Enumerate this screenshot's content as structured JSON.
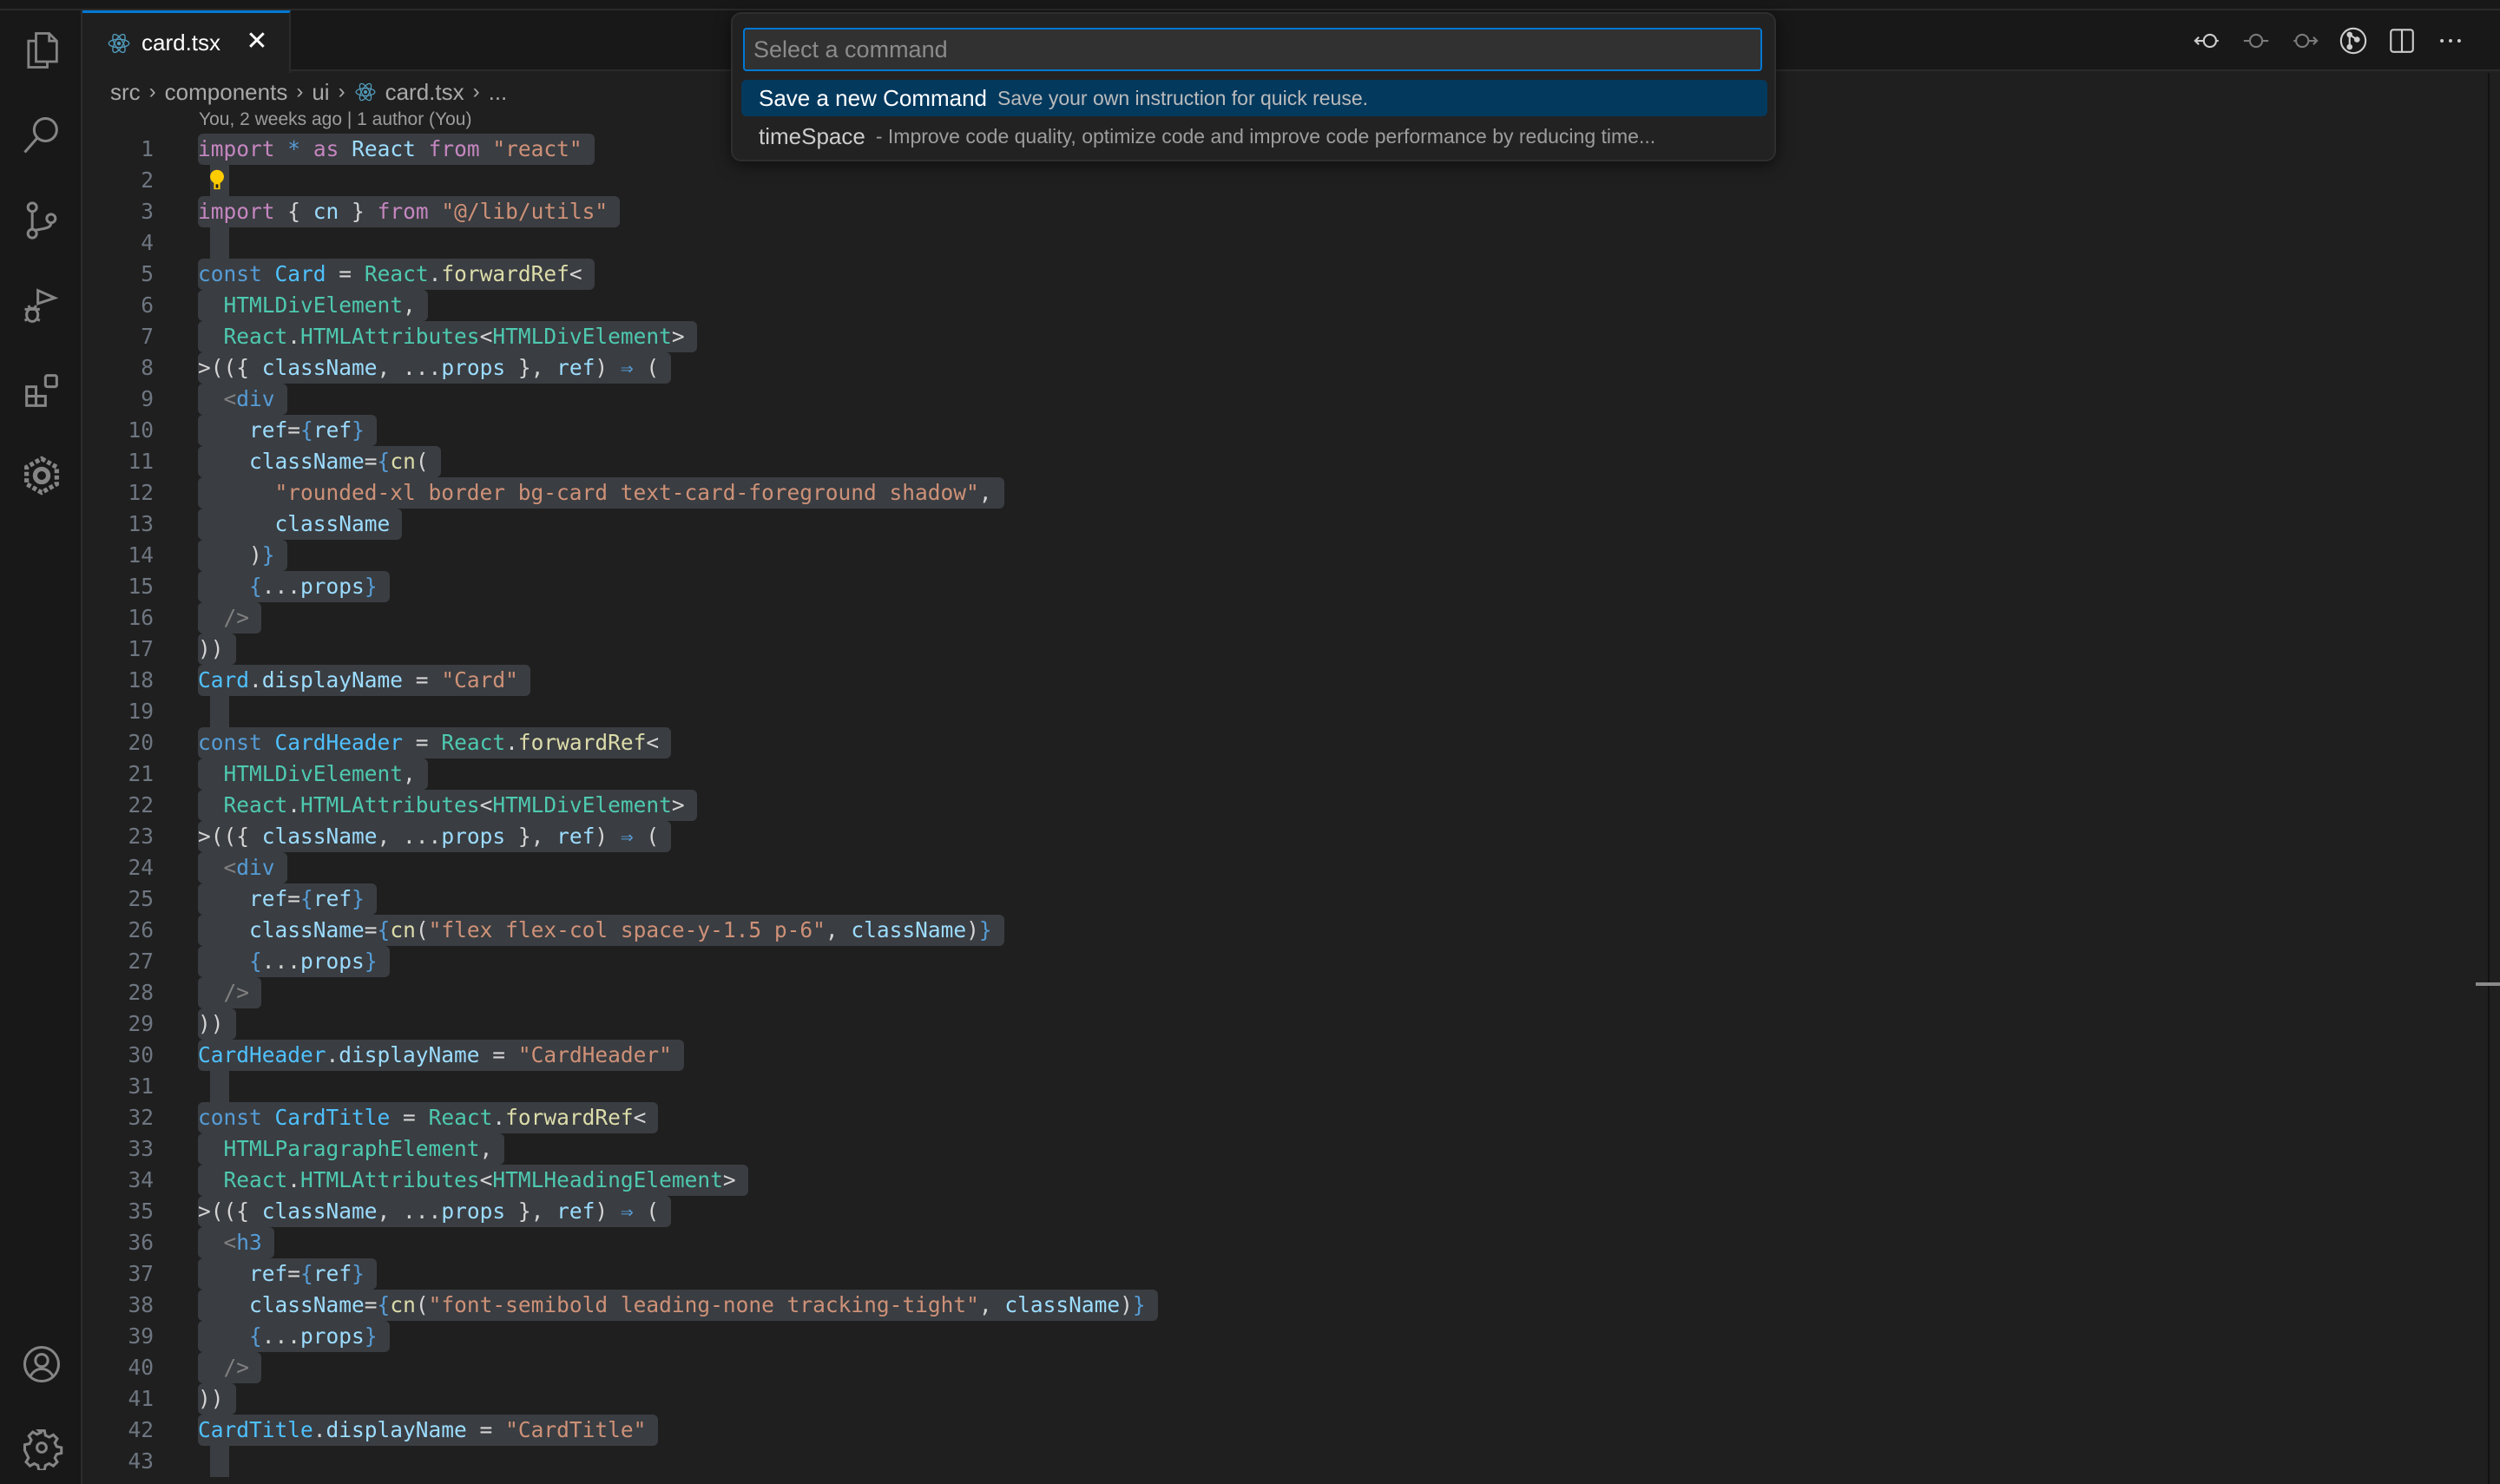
{
  "tab": {
    "label": "card.tsx",
    "close": "✕",
    "icon": "react-icon"
  },
  "breadcrumb": {
    "items": [
      "src",
      "components",
      "ui",
      "card.tsx",
      "..."
    ],
    "separator": "›"
  },
  "blame": "You, 2 weeks ago | 1 author (You)",
  "activity_bar": [
    "explorer-icon",
    "search-icon",
    "source-control-icon",
    "run-debug-icon",
    "extensions-icon",
    "extension-hexagon-icon",
    "accounts-icon",
    "manage-gear-icon"
  ],
  "editor_actions": [
    "go-back-icon",
    "timeline-icon",
    "go-forward-icon",
    "git-graph-icon",
    "split-editor-icon",
    "more-actions-icon"
  ],
  "palette": {
    "placeholder": "Select a command",
    "value": "",
    "items": [
      {
        "label": "Save a new Command",
        "description": "Save your own instruction for quick reuse.",
        "active": true
      },
      {
        "label": "timeSpace",
        "description": "- Improve code quality, optimize code and improve code performance by reducing time...",
        "active": false
      }
    ]
  },
  "code": {
    "lines": [
      [
        [
          "kw",
          "import"
        ],
        [
          "p",
          " "
        ],
        [
          "st",
          "*"
        ],
        [
          "p",
          " "
        ],
        [
          "kw",
          "as"
        ],
        [
          "p",
          " "
        ],
        [
          "id",
          "React"
        ],
        [
          "p",
          " "
        ],
        [
          "kw",
          "from"
        ],
        [
          "p",
          " "
        ],
        [
          "s",
          "\"react\""
        ]
      ],
      [],
      [
        [
          "kw",
          "import"
        ],
        [
          "p",
          " { "
        ],
        [
          "id",
          "cn"
        ],
        [
          "p",
          " } "
        ],
        [
          "kw",
          "from"
        ],
        [
          "p",
          " "
        ],
        [
          "s",
          "\"@/lib/utils\""
        ]
      ],
      [],
      [
        [
          "st",
          "const"
        ],
        [
          "p",
          " "
        ],
        [
          "cn",
          "Card"
        ],
        [
          "p",
          " = "
        ],
        [
          "ty",
          "React"
        ],
        [
          "p",
          "."
        ],
        [
          "fn",
          "forwardRef"
        ],
        [
          "p",
          "<"
        ]
      ],
      [
        [
          "p",
          "  "
        ],
        [
          "ty",
          "HTMLDivElement"
        ],
        [
          "p",
          ","
        ]
      ],
      [
        [
          "p",
          "  "
        ],
        [
          "ty",
          "React"
        ],
        [
          "p",
          "."
        ],
        [
          "ty",
          "HTMLAttributes"
        ],
        [
          "p",
          "<"
        ],
        [
          "ty",
          "HTMLDivElement"
        ],
        [
          "p",
          ">"
        ]
      ],
      [
        [
          "p",
          ">(({ "
        ],
        [
          "id",
          "className"
        ],
        [
          "p",
          ", "
        ],
        [
          "p",
          "..."
        ],
        [
          "id",
          "props"
        ],
        [
          "p",
          " }, "
        ],
        [
          "id",
          "ref"
        ],
        [
          "p",
          ") "
        ],
        [
          "ar",
          "⇒"
        ],
        [
          "p",
          " ("
        ]
      ],
      [
        [
          "p",
          "  "
        ],
        [
          "tg",
          "<"
        ],
        [
          "st",
          "div"
        ]
      ],
      [
        [
          "p",
          "    "
        ],
        [
          "id",
          "ref"
        ],
        [
          "p",
          "="
        ],
        [
          "br",
          "{"
        ],
        [
          "id",
          "ref"
        ],
        [
          "br",
          "}"
        ]
      ],
      [
        [
          "p",
          "    "
        ],
        [
          "id",
          "className"
        ],
        [
          "p",
          "="
        ],
        [
          "br",
          "{"
        ],
        [
          "fn",
          "cn"
        ],
        [
          "p",
          "("
        ]
      ],
      [
        [
          "p",
          "      "
        ],
        [
          "s",
          "\"rounded-xl border bg-card text-card-foreground shadow\""
        ],
        [
          "p",
          ","
        ]
      ],
      [
        [
          "p",
          "      "
        ],
        [
          "id",
          "className"
        ]
      ],
      [
        [
          "p",
          "    "
        ],
        [
          "p",
          ")"
        ],
        [
          "br",
          "}"
        ]
      ],
      [
        [
          "p",
          "    "
        ],
        [
          "br",
          "{"
        ],
        [
          "p",
          "..."
        ],
        [
          "id",
          "props"
        ],
        [
          "br",
          "}"
        ]
      ],
      [
        [
          "p",
          "  "
        ],
        [
          "tg",
          "/>"
        ]
      ],
      [
        [
          "p",
          "))"
        ]
      ],
      [
        [
          "cn",
          "Card"
        ],
        [
          "p",
          "."
        ],
        [
          "id",
          "displayName"
        ],
        [
          "p",
          " = "
        ],
        [
          "s",
          "\"Card\""
        ]
      ],
      [],
      [
        [
          "st",
          "const"
        ],
        [
          "p",
          " "
        ],
        [
          "cn",
          "CardHeader"
        ],
        [
          "p",
          " = "
        ],
        [
          "ty",
          "React"
        ],
        [
          "p",
          "."
        ],
        [
          "fn",
          "forwardRef"
        ],
        [
          "p",
          "<"
        ]
      ],
      [
        [
          "p",
          "  "
        ],
        [
          "ty",
          "HTMLDivElement"
        ],
        [
          "p",
          ","
        ]
      ],
      [
        [
          "p",
          "  "
        ],
        [
          "ty",
          "React"
        ],
        [
          "p",
          "."
        ],
        [
          "ty",
          "HTMLAttributes"
        ],
        [
          "p",
          "<"
        ],
        [
          "ty",
          "HTMLDivElement"
        ],
        [
          "p",
          ">"
        ]
      ],
      [
        [
          "p",
          ">(({ "
        ],
        [
          "id",
          "className"
        ],
        [
          "p",
          ", "
        ],
        [
          "p",
          "..."
        ],
        [
          "id",
          "props"
        ],
        [
          "p",
          " }, "
        ],
        [
          "id",
          "ref"
        ],
        [
          "p",
          ") "
        ],
        [
          "ar",
          "⇒"
        ],
        [
          "p",
          " ("
        ]
      ],
      [
        [
          "p",
          "  "
        ],
        [
          "tg",
          "<"
        ],
        [
          "st",
          "div"
        ]
      ],
      [
        [
          "p",
          "    "
        ],
        [
          "id",
          "ref"
        ],
        [
          "p",
          "="
        ],
        [
          "br",
          "{"
        ],
        [
          "id",
          "ref"
        ],
        [
          "br",
          "}"
        ]
      ],
      [
        [
          "p",
          "    "
        ],
        [
          "id",
          "className"
        ],
        [
          "p",
          "="
        ],
        [
          "br",
          "{"
        ],
        [
          "fn",
          "cn"
        ],
        [
          "p",
          "("
        ],
        [
          "s",
          "\"flex flex-col space-y-1.5 p-6\""
        ],
        [
          "p",
          ", "
        ],
        [
          "id",
          "className"
        ],
        [
          "p",
          ")"
        ],
        [
          "br",
          "}"
        ]
      ],
      [
        [
          "p",
          "    "
        ],
        [
          "br",
          "{"
        ],
        [
          "p",
          "..."
        ],
        [
          "id",
          "props"
        ],
        [
          "br",
          "}"
        ]
      ],
      [
        [
          "p",
          "  "
        ],
        [
          "tg",
          "/>"
        ]
      ],
      [
        [
          "p",
          "))"
        ]
      ],
      [
        [
          "cn",
          "CardHeader"
        ],
        [
          "p",
          "."
        ],
        [
          "id",
          "displayName"
        ],
        [
          "p",
          " = "
        ],
        [
          "s",
          "\"CardHeader\""
        ]
      ],
      [],
      [
        [
          "st",
          "const"
        ],
        [
          "p",
          " "
        ],
        [
          "cn",
          "CardTitle"
        ],
        [
          "p",
          " = "
        ],
        [
          "ty",
          "React"
        ],
        [
          "p",
          "."
        ],
        [
          "fn",
          "forwardRef"
        ],
        [
          "p",
          "<"
        ]
      ],
      [
        [
          "p",
          "  "
        ],
        [
          "ty",
          "HTMLParagraphElement"
        ],
        [
          "p",
          ","
        ]
      ],
      [
        [
          "p",
          "  "
        ],
        [
          "ty",
          "React"
        ],
        [
          "p",
          "."
        ],
        [
          "ty",
          "HTMLAttributes"
        ],
        [
          "p",
          "<"
        ],
        [
          "ty",
          "HTMLHeadingElement"
        ],
        [
          "p",
          ">"
        ]
      ],
      [
        [
          "p",
          ">(({ "
        ],
        [
          "id",
          "className"
        ],
        [
          "p",
          ", "
        ],
        [
          "p",
          "..."
        ],
        [
          "id",
          "props"
        ],
        [
          "p",
          " }, "
        ],
        [
          "id",
          "ref"
        ],
        [
          "p",
          ") "
        ],
        [
          "ar",
          "⇒"
        ],
        [
          "p",
          " ("
        ]
      ],
      [
        [
          "p",
          "  "
        ],
        [
          "tg",
          "<"
        ],
        [
          "st",
          "h3"
        ]
      ],
      [
        [
          "p",
          "    "
        ],
        [
          "id",
          "ref"
        ],
        [
          "p",
          "="
        ],
        [
          "br",
          "{"
        ],
        [
          "id",
          "ref"
        ],
        [
          "br",
          "}"
        ]
      ],
      [
        [
          "p",
          "    "
        ],
        [
          "id",
          "className"
        ],
        [
          "p",
          "="
        ],
        [
          "br",
          "{"
        ],
        [
          "fn",
          "cn"
        ],
        [
          "p",
          "("
        ],
        [
          "s",
          "\"font-semibold leading-none tracking-tight\""
        ],
        [
          "p",
          ", "
        ],
        [
          "id",
          "className"
        ],
        [
          "p",
          ")"
        ],
        [
          "br",
          "}"
        ]
      ],
      [
        [
          "p",
          "    "
        ],
        [
          "br",
          "{"
        ],
        [
          "p",
          "..."
        ],
        [
          "id",
          "props"
        ],
        [
          "br",
          "}"
        ]
      ],
      [
        [
          "p",
          "  "
        ],
        [
          "tg",
          "/>"
        ]
      ],
      [
        [
          "p",
          "))"
        ]
      ],
      [
        [
          "cn",
          "CardTitle"
        ],
        [
          "p",
          "."
        ],
        [
          "id",
          "displayName"
        ],
        [
          "p",
          " = "
        ],
        [
          "s",
          "\"CardTitle\""
        ]
      ],
      []
    ],
    "lightbulb_line": 2
  }
}
